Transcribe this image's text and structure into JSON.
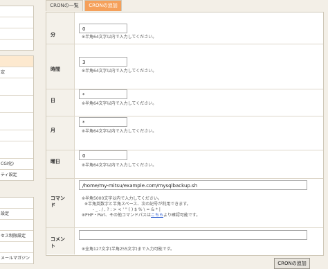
{
  "sidebar": {
    "items_upper": [
      "",
      "",
      "",
      ""
    ],
    "items_lower": [
      "",
      "定",
      "",
      "",
      "",
      "",
      "",
      "CGI化)",
      "ティ設定"
    ],
    "items_bottom": [
      "",
      "設定",
      "",
      "セス制限設定",
      "",
      "メールマガジン"
    ]
  },
  "tabs": [
    {
      "label": "CRONの一覧"
    },
    {
      "label": "CRONの追加"
    }
  ],
  "form": {
    "minute": {
      "label": "分",
      "value": "0",
      "note": "※半角64文字以内で入力してください。"
    },
    "hour": {
      "label": "時間",
      "value": "3",
      "note": "※半角64文字以内で入力してください。"
    },
    "day": {
      "label": "日",
      "value": "*",
      "note": "※半角64文字以内で入力してください。"
    },
    "month": {
      "label": "月",
      "value": "*",
      "note": "※半角64文字以内で入力してください。"
    },
    "weekday": {
      "label": "曜日",
      "value": "0",
      "note": "※半角64文字以内で入力してください。"
    },
    "command": {
      "label_line1": "コマン",
      "label_line2": "ド",
      "value": "/home/my-mitsu/example.com/mysqlbackup.sh",
      "note1": "※半角5000文字以内で入力してください。",
      "note2": "※半角英数字と半角スペース、次の記号が利用できます。",
      "note3": "- _ . / , ? : > < ' \" ( ) $ % \\ = & * |",
      "note4_prefix": "※PHP・Perl、その他コマンドパスは",
      "note4_link": "こちら",
      "note4_suffix": "より確認可能です。"
    },
    "comment": {
      "label_line1": "コメン",
      "label_line2": "ト",
      "value": "",
      "note": "※全角127文字(半角255文字)まで入力可能です。"
    }
  },
  "submit_label": "CRONの追加"
}
